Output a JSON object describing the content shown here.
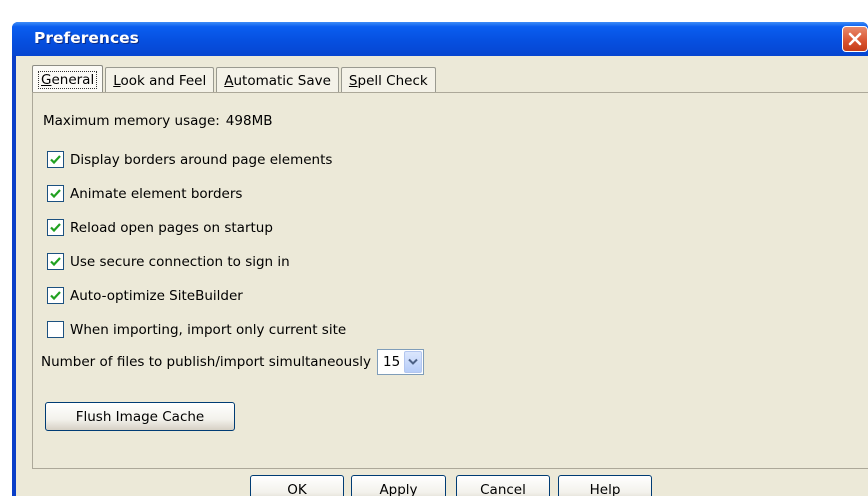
{
  "window": {
    "title": "Preferences"
  },
  "tabs": [
    {
      "label": "General",
      "underline": "G",
      "rest": "eneral"
    },
    {
      "label": "Look and Feel",
      "underline": "L",
      "rest": "ook and Feel"
    },
    {
      "label": "Automatic Save",
      "underline": "A",
      "rest": "utomatic Save"
    },
    {
      "label": "Spell Check",
      "underline": "S",
      "rest": "pell Check"
    }
  ],
  "general": {
    "memory_label": "Maximum memory usage:",
    "memory_value": "498MB",
    "checkboxes": [
      {
        "label": "Display borders around page elements",
        "checked": true
      },
      {
        "label": "Animate element borders",
        "checked": true
      },
      {
        "label": "Reload open pages on startup",
        "checked": true
      },
      {
        "label": "Use secure connection to sign in",
        "checked": true
      },
      {
        "label": "Auto-optimize SiteBuilder",
        "checked": true
      },
      {
        "label": "When importing, import only current site",
        "checked": false
      }
    ],
    "files_label": "Number of files to publish/import simultaneously",
    "files_value": "15",
    "flush_button": "Flush Image Cache"
  },
  "footer": {
    "ok": "OK",
    "apply": "Apply",
    "cancel": "Cancel",
    "help": "Help"
  },
  "colors": {
    "title_bar": "#0645d0",
    "dialog_bg": "#ece9d8",
    "check": "#21a121",
    "close": "#d9532f"
  },
  "icons": {
    "close": "close-icon",
    "check": "check-icon",
    "dropdown": "chevron-down-icon"
  }
}
